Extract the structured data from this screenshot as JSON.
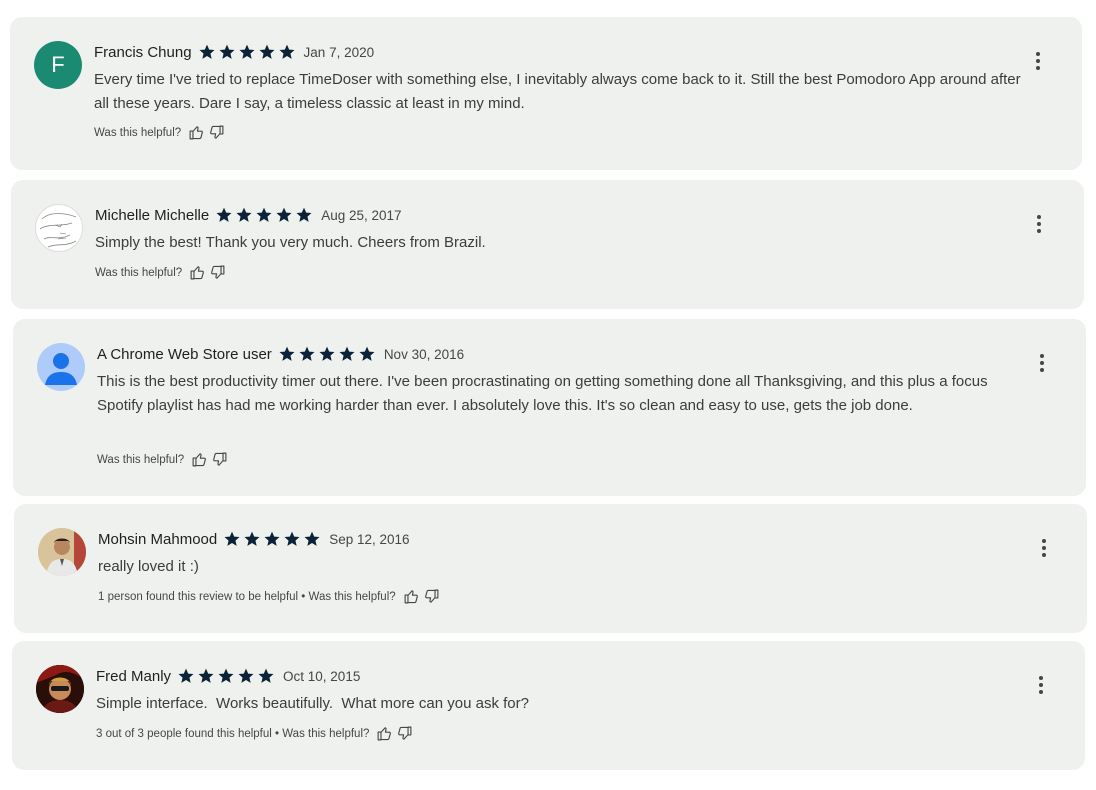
{
  "colors": {
    "card_bg": "#eff1ee",
    "star": "#0b2239",
    "avatar_f": "#1b8a72"
  },
  "reviews": [
    {
      "author": "Francis Chung",
      "avatar_letter": "F",
      "rating": 5,
      "date": "Jan 7, 2020",
      "text": "Every time I've tried to replace TimeDoser with something else, I inevitably always come back to it. Still the best Pomodoro App around after all these years. Dare I say, a timeless classic at least in my mind.",
      "helpful": "Was this helpful?"
    },
    {
      "author": "Michelle Michelle",
      "rating": 5,
      "date": "Aug 25, 2017",
      "text": "Simply the best! Thank you very much. Cheers from Brazil.",
      "helpful": "Was this helpful?"
    },
    {
      "author": "A Chrome Web Store user",
      "rating": 5,
      "date": "Nov 30, 2016",
      "text": "This is the best productivity timer out there. I've been procrastinating on getting something done all Thanksgiving, and this plus a focus Spotify playlist has had me working harder than ever. I absolutely love this. It's so clean and easy to use, gets the job done.",
      "helpful": "Was this helpful?"
    },
    {
      "author": "Mohsin Mahmood",
      "rating": 5,
      "date": "Sep 12, 2016",
      "text": "really loved it :)",
      "helpful": "1 person found this review to be helpful • Was this helpful?"
    },
    {
      "author": "Fred Manly",
      "rating": 5,
      "date": "Oct 10, 2015",
      "text": "Simple interface.  Works beautifully.  What more can you ask for?",
      "helpful": "3 out of 3 people found this helpful • Was this helpful?"
    }
  ]
}
